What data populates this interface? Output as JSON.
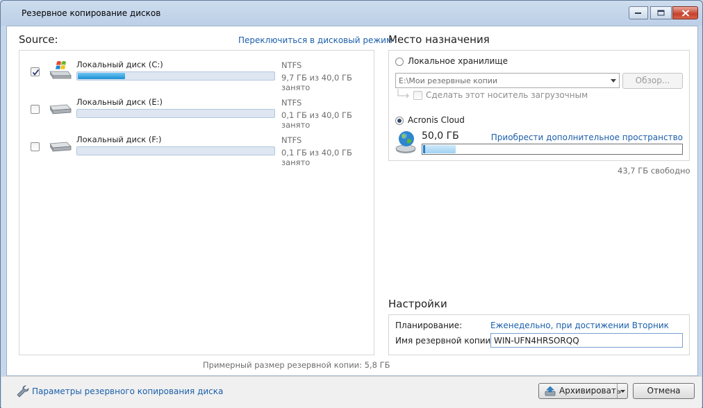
{
  "window": {
    "title": "Резервное копирование дисков"
  },
  "source": {
    "heading": "Source:",
    "switch_link": "Переключиться в дисковый режим",
    "disks": [
      {
        "label": "Локальный диск (C:)",
        "fs": "NTFS",
        "usage": "9,7 ГБ из 40,0 ГБ занято",
        "checked": true,
        "fill_fraction": 0.24,
        "icon": "windows-drive-icon"
      },
      {
        "label": "Локальный диск (E:)",
        "fs": "NTFS",
        "usage": "0,1 ГБ из 40,0 ГБ занято",
        "checked": false,
        "fill_fraction": 0.0,
        "icon": "hard-drive-icon"
      },
      {
        "label": "Локальный диск (F:)",
        "fs": "NTFS",
        "usage": "0,1 ГБ из 40,0 ГБ занято",
        "checked": false,
        "fill_fraction": 0.0,
        "icon": "hard-drive-icon"
      }
    ],
    "estimate": "Примерный размер резервной копии: 5,8 ГБ"
  },
  "destination": {
    "heading": "Место назначения",
    "local_label": "Локальное хранилище",
    "local_path": "E:\\Мои резервные копии",
    "browse_label": "Обзор...",
    "bootable_label": "Сделать этот носитель загрузочным",
    "cloud_label": "Acronis Cloud",
    "cloud_size": "50,0 ГБ",
    "buy_link": "Приобрести дополнительное пространство",
    "cloud_fill_fraction": 0.125,
    "free_text": "43,7 ГБ свободно"
  },
  "settings": {
    "heading": "Настройки",
    "schedule_label": "Планирование:",
    "schedule_value": "Еженедельно, при достижении Вторник",
    "name_label": "Имя резервной копии:",
    "name_value": "WIN-UFN4HRSORQQ"
  },
  "footer": {
    "options_link": "Параметры резервного копирования диска",
    "archive_button": "Архивировать",
    "cancel_button": "Отмена"
  },
  "colors": {
    "accent_link": "#1b5fab",
    "bar_fill": "#1b8fd4"
  }
}
